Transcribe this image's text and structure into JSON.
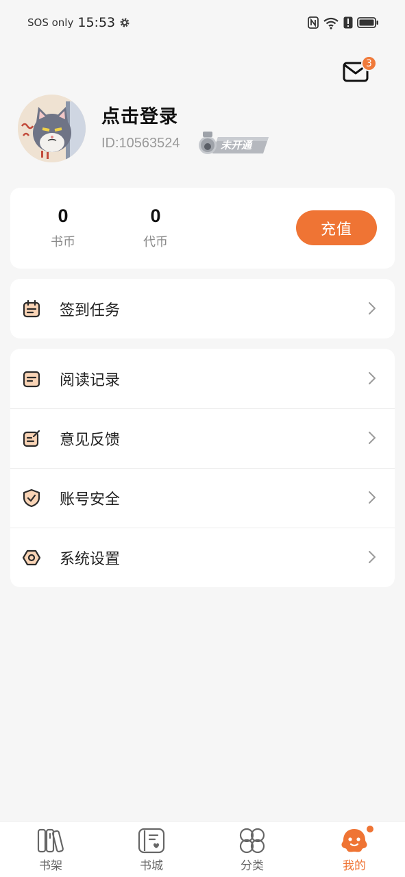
{
  "status_bar": {
    "carrier": "SOS only",
    "time": "15:53"
  },
  "header": {
    "mail_badge_count": "3"
  },
  "profile": {
    "login_prompt": "点击登录",
    "user_id": "ID:10563524",
    "vip_status": "未开通"
  },
  "wallet": {
    "book_coins_value": "0",
    "book_coins_label": "书币",
    "vouchers_value": "0",
    "vouchers_label": "代币",
    "recharge_label": "充值"
  },
  "checkin": {
    "label": "签到任务"
  },
  "menu": {
    "items": [
      {
        "label": "阅读记录",
        "icon": "reading-record-icon"
      },
      {
        "label": "意见反馈",
        "icon": "feedback-icon"
      },
      {
        "label": "账号安全",
        "icon": "shield-check-icon"
      },
      {
        "label": "系统设置",
        "icon": "settings-hex-icon"
      }
    ]
  },
  "bottom_nav": {
    "items": [
      {
        "label": "书架",
        "icon": "bookshelf-icon"
      },
      {
        "label": "书城",
        "icon": "bookstore-icon"
      },
      {
        "label": "分类",
        "icon": "category-icon"
      },
      {
        "label": "我的",
        "icon": "mine-icon",
        "active": true
      }
    ]
  },
  "colors": {
    "accent": "#ef7434",
    "background": "#f6f6f6",
    "card": "#ffffff"
  }
}
